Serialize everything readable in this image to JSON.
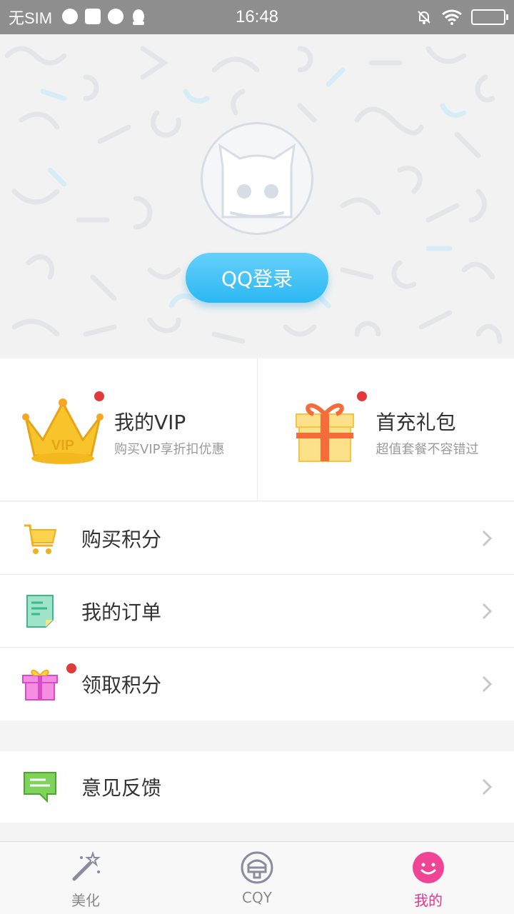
{
  "status_bar": {
    "carrier": "无SIM",
    "time": "16:48",
    "icons": [
      "shield-icon",
      "android-icon",
      "paint-icon",
      "qq-penguin-icon"
    ],
    "right_icons": [
      "silent-bell-icon",
      "wifi-icon",
      "battery-icon"
    ]
  },
  "header": {
    "login_label": "QQ登录",
    "avatar_icon": "cat-avatar-icon"
  },
  "promo": [
    {
      "title": "我的VIP",
      "subtitle": "购买VIP享折扣优惠",
      "icon": "crown-icon",
      "badge": true
    },
    {
      "title": "首充礼包",
      "subtitle": "超值套餐不容错过",
      "icon": "gift-box-icon",
      "badge": true
    }
  ],
  "menu": [
    {
      "label": "购买积分",
      "icon": "cart-icon",
      "badge": false
    },
    {
      "label": "我的订单",
      "icon": "order-doc-icon",
      "badge": false
    },
    {
      "label": "领取积分",
      "icon": "present-icon",
      "badge": true
    }
  ],
  "menu2": [
    {
      "label": "意见反馈",
      "icon": "feedback-icon",
      "badge": false
    }
  ],
  "tabs": [
    {
      "label": "美化",
      "icon": "magic-wand-icon",
      "active": false
    },
    {
      "label": "CQY",
      "icon": "cqy-icon",
      "active": false
    },
    {
      "label": "我的",
      "icon": "smile-icon",
      "active": true
    }
  ],
  "colors": {
    "accent_blue": "#2bb8f2",
    "active_pink": "#e8338e",
    "badge_red": "#e23a3a",
    "status_bar": "#8e8e8e"
  }
}
